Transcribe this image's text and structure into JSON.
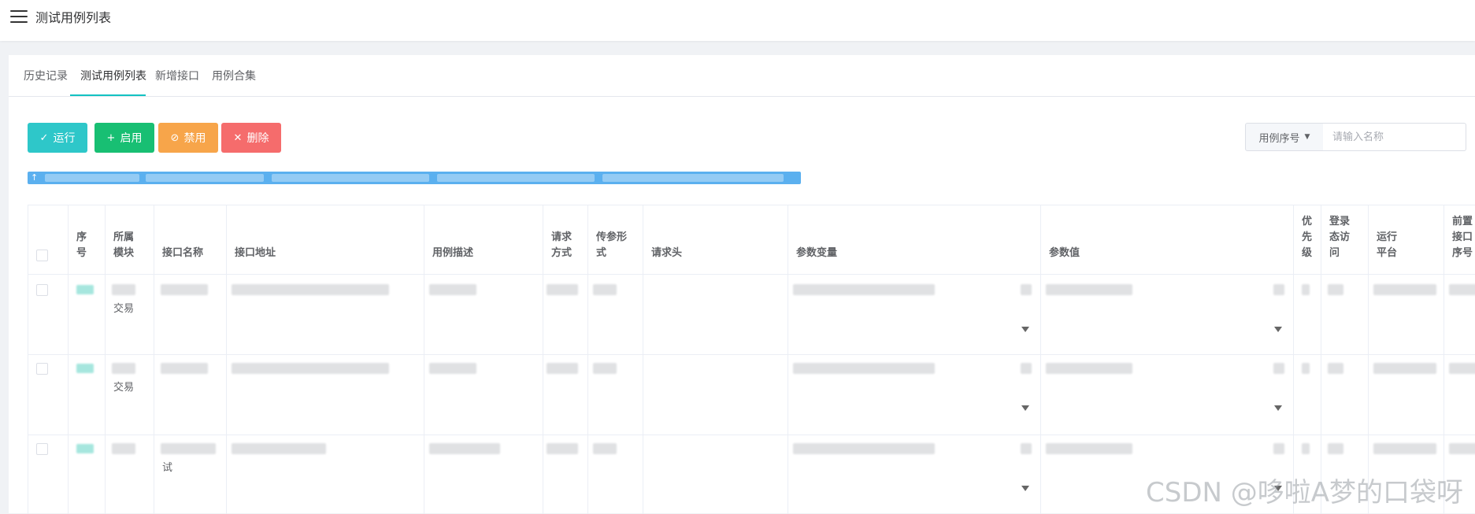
{
  "app": {
    "title": "测试用例列表"
  },
  "tabs": [
    {
      "label": "历史记录"
    },
    {
      "label": "测试用例列表"
    },
    {
      "label": "新增接口"
    },
    {
      "label": "用例合集"
    }
  ],
  "toolbar": {
    "run_label": "运行",
    "enable_label": "启用",
    "disable_label": "禁用",
    "delete_label": "删除",
    "search_select": "用例序号",
    "search_placeholder": "请输入名称"
  },
  "info_bar": {
    "icon": "arrow-up-icon"
  },
  "table": {
    "headers": {
      "index": [
        "序",
        "号"
      ],
      "module": [
        "所属",
        "模块"
      ],
      "name": "接口名称",
      "address": "接口地址",
      "desc": "用例描述",
      "method": [
        "请求",
        "方式"
      ],
      "param_form": [
        "传参形",
        "式"
      ],
      "req_header": "请求头",
      "param_var": "参数变量",
      "param_val": "参数值",
      "priority": [
        "优",
        "先",
        "级"
      ],
      "login": [
        "登录",
        "态访",
        "问"
      ],
      "platform": [
        "运行",
        "平台"
      ],
      "pre": [
        "前置",
        "接口",
        "序号"
      ]
    },
    "rows": [
      {
        "module_tail": "交易",
        "name_tail": ""
      },
      {
        "module_tail": "交易",
        "name_tail": ""
      },
      {
        "module_tail": "",
        "name_tail": "试"
      }
    ]
  },
  "watermark": "CSDN @哆啦A梦的口袋呀",
  "colors": {
    "run": "#2ec7c9",
    "enable": "#18bf73",
    "disable": "#f7a54a",
    "delete": "#f56c6c",
    "tab_active": "#13c2c2",
    "info_bar": "#5bb0ef"
  }
}
